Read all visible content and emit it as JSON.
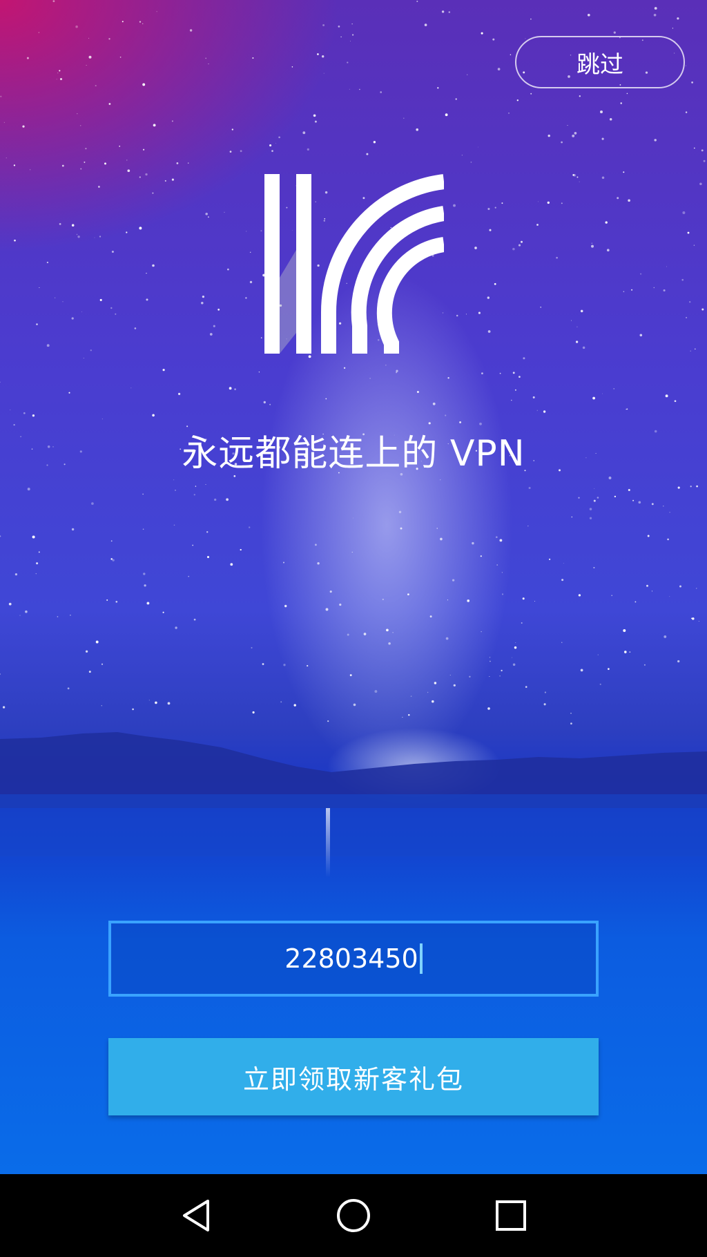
{
  "header": {
    "skip_label": "跳过"
  },
  "brand": {
    "logo_icon": "k-stripes-logo-icon",
    "tagline": "永远都能连上的 VPN"
  },
  "form": {
    "code_value": "22803450",
    "claim_label": "立即领取新客礼包"
  },
  "colors": {
    "input_border": "#3aa3ff",
    "claim_button": "#31aeea",
    "nav_bar": "#000000"
  },
  "navbar": {
    "back_icon": "back-triangle-icon",
    "home_icon": "home-circle-icon",
    "recent_icon": "recent-apps-square-icon"
  }
}
